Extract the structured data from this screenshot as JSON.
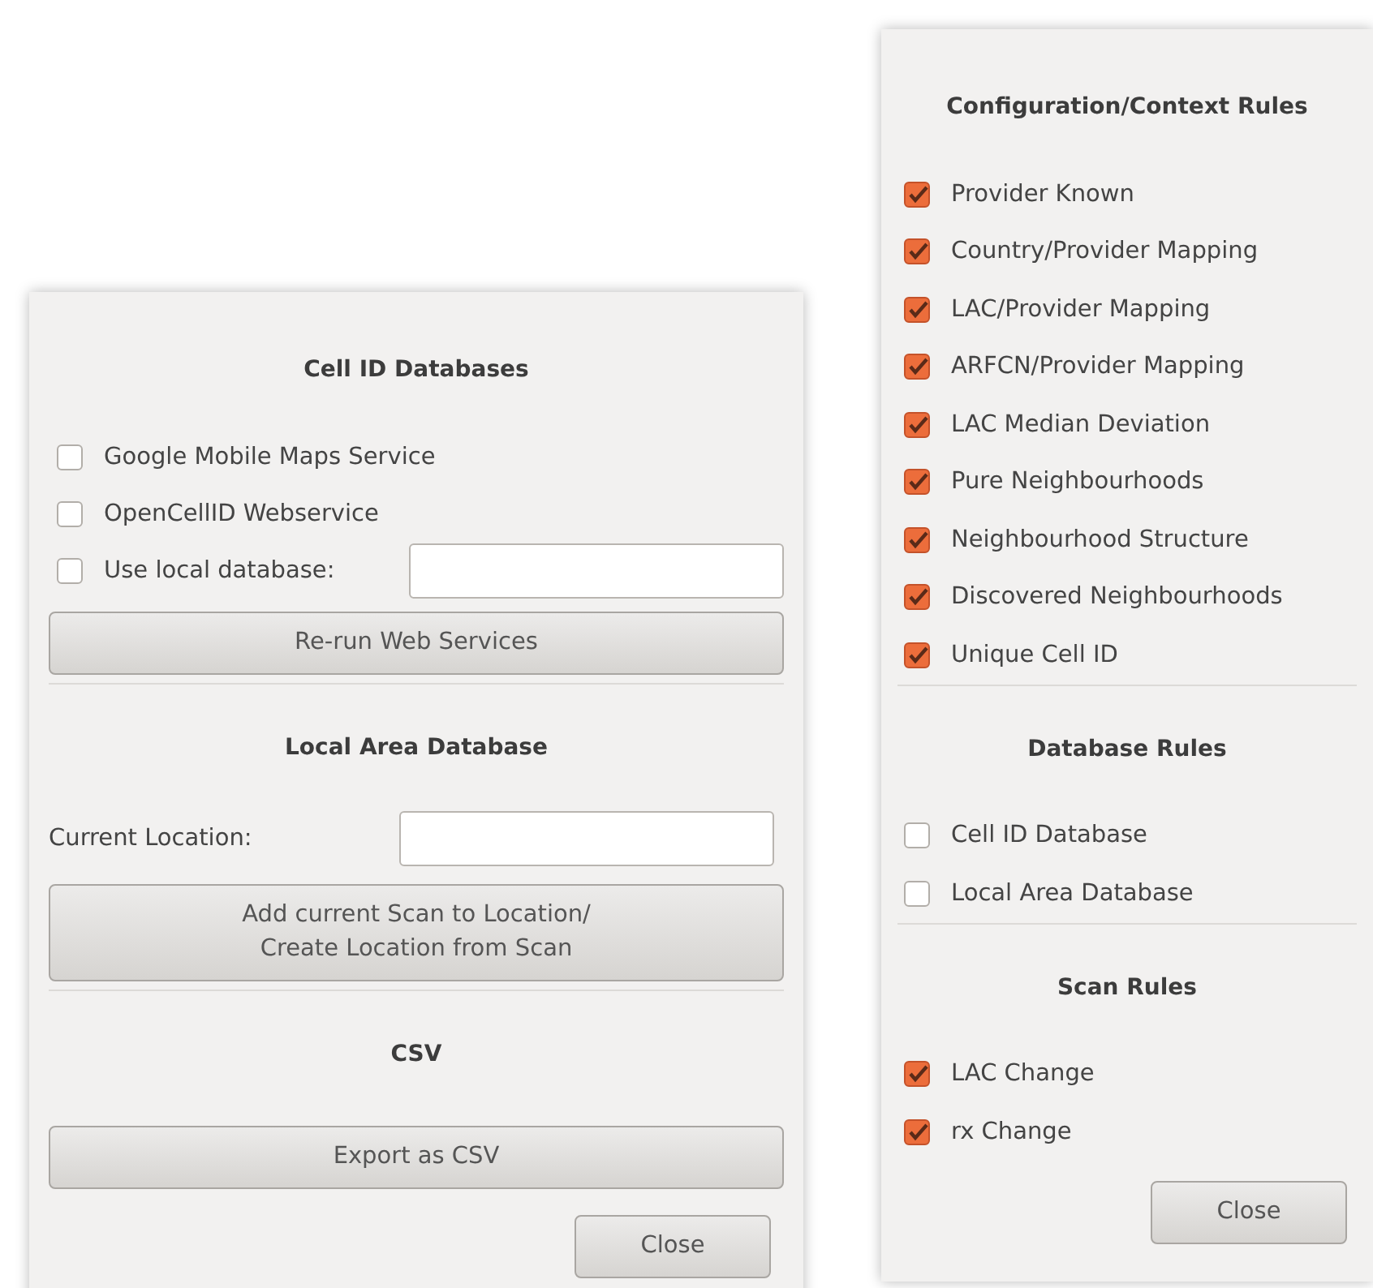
{
  "left_dialog": {
    "sections": [
      {
        "title": "Cell ID Databases",
        "rows": [
          {
            "kind": "checkbox",
            "label": "Google Mobile Maps Service",
            "checked": false
          },
          {
            "kind": "checkbox",
            "label": "OpenCellID Webservice",
            "checked": false
          },
          {
            "kind": "checkbox_field",
            "label": "Use local database:",
            "checked": false
          },
          {
            "kind": "button",
            "label": "Re-run Web Services"
          }
        ]
      },
      {
        "title": "Local Area Database",
        "rows": [
          {
            "kind": "field",
            "label": "Current Location:"
          },
          {
            "kind": "button",
            "label": "Add current Scan to Location/\nCreate Location from Scan"
          }
        ]
      },
      {
        "title": "CSV",
        "rows": [
          {
            "kind": "button",
            "label": "Export as CSV"
          }
        ]
      }
    ],
    "close_button": "Close"
  },
  "right_dialog": {
    "sections": [
      {
        "title": "Configuration/Context Rules",
        "rows": [
          {
            "kind": "checkbox",
            "label": "Provider Known",
            "checked": true
          },
          {
            "kind": "checkbox",
            "label": "Country/Provider Mapping",
            "checked": true
          },
          {
            "kind": "checkbox",
            "label": "LAC/Provider Mapping",
            "checked": true
          },
          {
            "kind": "checkbox",
            "label": "ARFCN/Provider Mapping",
            "checked": true
          },
          {
            "kind": "checkbox",
            "label": "LAC Median Deviation",
            "checked": true
          },
          {
            "kind": "checkbox",
            "label": "Pure Neighbourhoods",
            "checked": true
          },
          {
            "kind": "checkbox",
            "label": "Neighbourhood Structure",
            "checked": true
          },
          {
            "kind": "checkbox",
            "label": "Discovered Neighbourhoods",
            "checked": true
          },
          {
            "kind": "checkbox",
            "label": "Unique Cell ID",
            "checked": true
          }
        ]
      },
      {
        "title": "Database Rules",
        "rows": [
          {
            "kind": "checkbox",
            "label": "Cell ID Database",
            "checked": false
          },
          {
            "kind": "checkbox",
            "label": "Local Area Database",
            "checked": false
          }
        ]
      },
      {
        "title": "Scan Rules",
        "rows": [
          {
            "kind": "checkbox",
            "label": "LAC Change",
            "checked": true
          },
          {
            "kind": "checkbox",
            "label": "rx Change",
            "checked": true
          }
        ]
      }
    ],
    "close_button": "Close"
  }
}
